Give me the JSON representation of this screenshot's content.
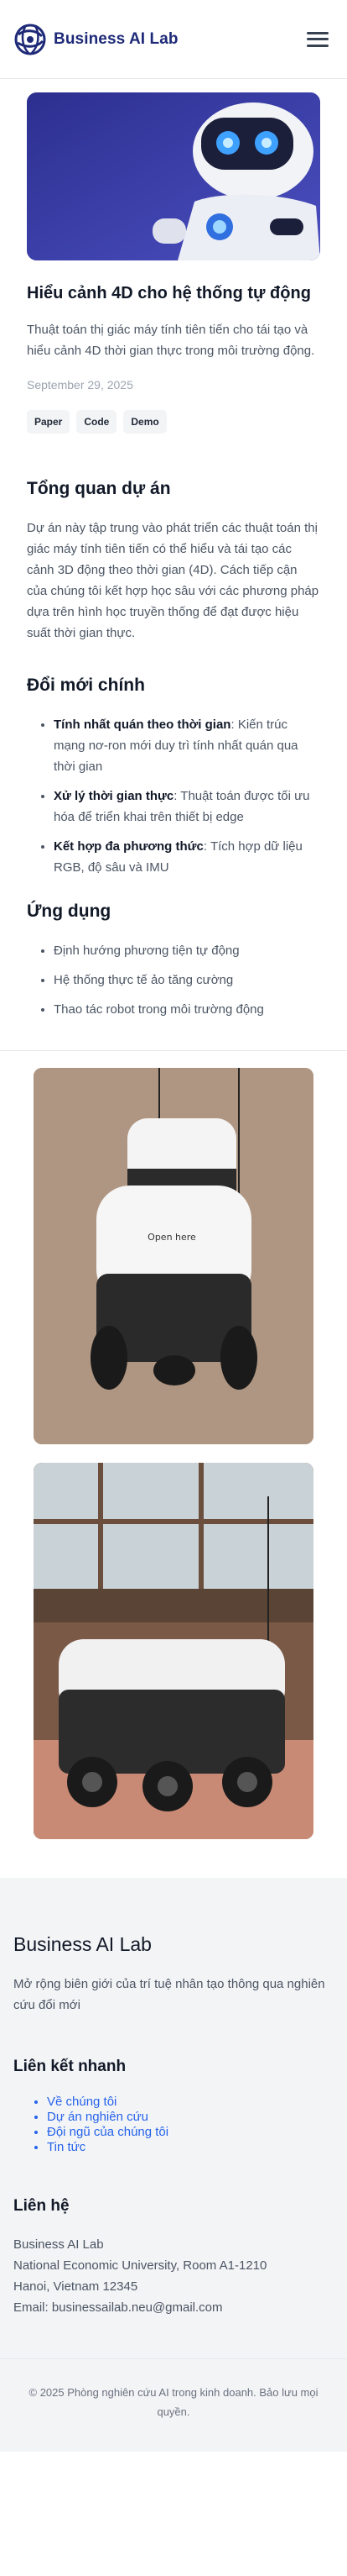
{
  "header": {
    "logo_text": "Business AI Lab",
    "logo_icon": "globe-swirl-icon",
    "menu_icon": "hamburger-menu-icon"
  },
  "article": {
    "title": "Hiểu cảnh 4D cho hệ thống tự động",
    "description": "Thuật toán thị giác máy tính tiên tiến cho tái tạo và hiểu cảnh 4D thời gian thực trong môi trường động.",
    "date": "September 29, 2025",
    "tags": [
      "Paper",
      "Code",
      "Demo"
    ]
  },
  "overview": {
    "heading": "Tổng quan dự án",
    "text": "Dự án này tập trung vào phát triển các thuật toán thị giác máy tính tiên tiến có thể hiểu và tái tạo các cảnh 3D động theo thời gian (4D). Cách tiếp cận của chúng tôi kết hợp học sâu với các phương pháp dựa trên hình học truyền thống để đạt được hiệu suất thời gian thực."
  },
  "innovations": {
    "heading": "Đổi mới chính",
    "items": [
      {
        "bold": "Tính nhất quán theo thời gian",
        "text": ": Kiến trúc mạng nơ-ron mới duy trì tính nhất quán qua thời gian"
      },
      {
        "bold": "Xử lý thời gian thực",
        "text": ": Thuật toán được tối ưu hóa để triển khai trên thiết bị edge"
      },
      {
        "bold": "Kết hợp đa phương thức",
        "text": ": Tích hợp dữ liệu RGB, độ sâu và IMU"
      }
    ]
  },
  "applications": {
    "heading": "Ứng dụng",
    "items": [
      "Định hướng phương tiện tự động",
      "Hệ thống thực tế ảo tăng cường",
      "Thao tác robot trong môi trường động"
    ]
  },
  "gallery": {
    "robot_label": "Open here"
  },
  "footer": {
    "title": "Business AI Lab",
    "description": "Mở rộng biên giới của trí tuệ nhân tạo thông qua nghiên cứu đổi mới",
    "quick_links_heading": "Liên kết nhanh",
    "quick_links": [
      "Về chúng tôi",
      "Dự án nghiên cứu",
      "Đội ngũ của chúng tôi",
      "Tin tức"
    ],
    "contact_heading": "Liên hệ",
    "contact_lines": [
      "Business AI Lab",
      "National Economic University, Room A1-1210",
      "Hanoi, Vietnam 12345",
      "Email: businessailab.neu@gmail.com"
    ],
    "copyright": "© 2025 Phòng nghiên cứu AI trong kinh doanh. Bảo lưu mọi quyền."
  }
}
